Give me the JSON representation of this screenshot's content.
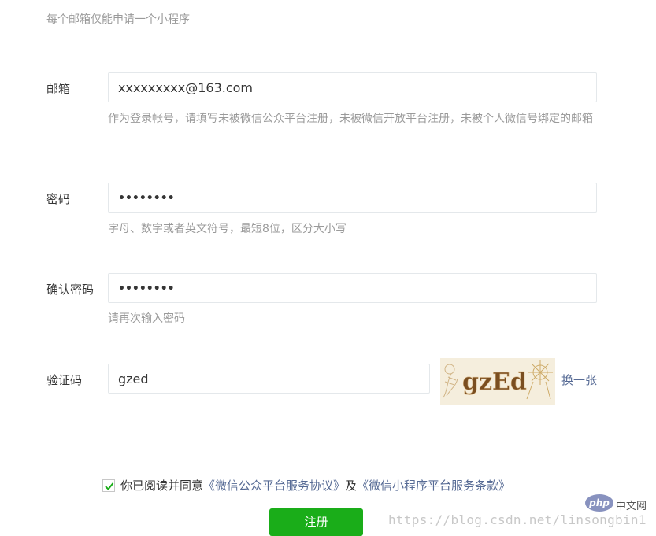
{
  "notice": "每个邮箱仅能申请一个小程序",
  "email": {
    "label": "邮箱",
    "value": "xxxxxxxxx@163.com",
    "hint": "作为登录帐号，请填写未被微信公众平台注册，未被微信开放平台注册，未被个人微信号绑定的邮箱"
  },
  "password": {
    "label": "密码",
    "value": "••••••••",
    "hint": "字母、数字或者英文符号，最短8位，区分大小写"
  },
  "confirm": {
    "label": "确认密码",
    "value": "••••••••",
    "hint": "请再次输入密码"
  },
  "captcha": {
    "label": "验证码",
    "value": "gzed",
    "image_text": "gzEd",
    "refresh": "换一张"
  },
  "agreement": {
    "prefix": "你已阅读并同意",
    "link1": "《微信公众平台服务协议》",
    "middle": "及",
    "link2": "《微信小程序平台服务条款》",
    "checked": true
  },
  "submit_label": "注册",
  "watermark": "https://blog.csdn.net/linsongbin1",
  "logo": {
    "php": "php",
    "cn": "中文网"
  },
  "colors": {
    "accent_green": "#1aad19",
    "link_blue": "#576b95",
    "hint_gray": "#9a9a9a"
  }
}
